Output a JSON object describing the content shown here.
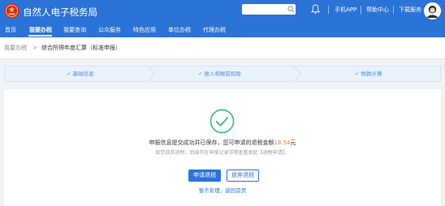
{
  "header": {
    "app_title": "自然人电子税务局",
    "search_placeholder": "",
    "links": [
      "手机APP",
      "帮助中心",
      "下载服务"
    ]
  },
  "nav": {
    "items": [
      "首页",
      "我要办税",
      "我要查询",
      "公众服务",
      "特色应用",
      "单位办税",
      "代理办税"
    ],
    "active": "我要办税"
  },
  "breadcrumb": {
    "parent": "我要办税",
    "separator": ">",
    "current": "综合所得年度汇算（标准申报）"
  },
  "steps": [
    {
      "label": "基础信息",
      "check": "✓"
    },
    {
      "label": "收入和税前扣除",
      "check": "✓"
    },
    {
      "label": "税款计算",
      "check": "✓"
    }
  ],
  "result": {
    "message_prefix": "申报信息提交成功并已保存，您可申请的退税金额",
    "amount": "18.54",
    "message_suffix": "元",
    "hint": "如您放弃退税，后续可在申报记录详情查看发起【退税申请】。",
    "primary_button": "申请退税",
    "secondary_button": "放弃退税",
    "home_link": "暂不处理，返回首页"
  },
  "colors": {
    "brand": "#2b73d6",
    "success": "#3bb77e",
    "amount": "#e6782b"
  }
}
